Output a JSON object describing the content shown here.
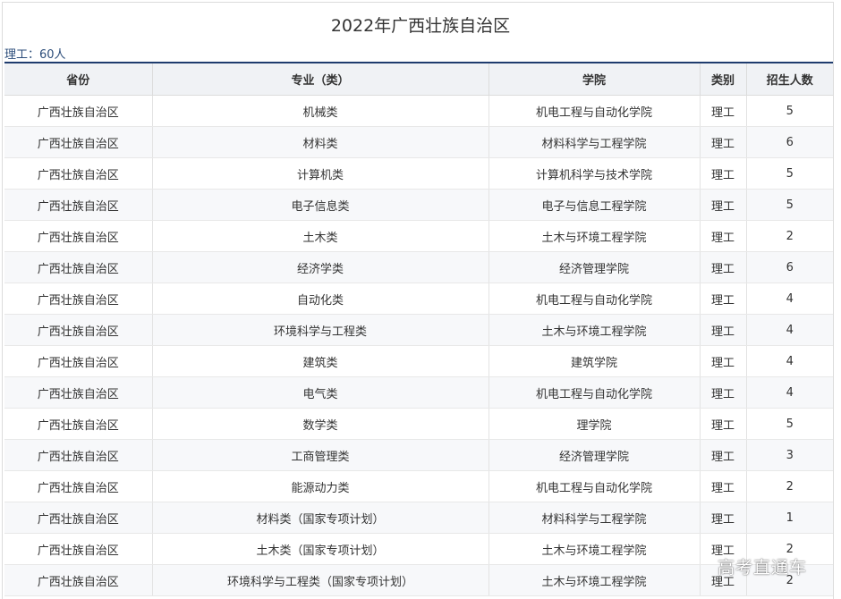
{
  "title": "2022年广西壮族自治区",
  "summary": "理工：60人",
  "table": {
    "headers": [
      "省份",
      "专业（类）",
      "学院",
      "类别",
      "招生人数"
    ],
    "rows": [
      [
        "广西壮族自治区",
        "机械类",
        "机电工程与自动化学院",
        "理工",
        "5"
      ],
      [
        "广西壮族自治区",
        "材料类",
        "材料科学与工程学院",
        "理工",
        "6"
      ],
      [
        "广西壮族自治区",
        "计算机类",
        "计算机科学与技术学院",
        "理工",
        "5"
      ],
      [
        "广西壮族自治区",
        "电子信息类",
        "电子与信息工程学院",
        "理工",
        "5"
      ],
      [
        "广西壮族自治区",
        "土木类",
        "土木与环境工程学院",
        "理工",
        "2"
      ],
      [
        "广西壮族自治区",
        "经济学类",
        "经济管理学院",
        "理工",
        "6"
      ],
      [
        "广西壮族自治区",
        "自动化类",
        "机电工程与自动化学院",
        "理工",
        "4"
      ],
      [
        "广西壮族自治区",
        "环境科学与工程类",
        "土木与环境工程学院",
        "理工",
        "4"
      ],
      [
        "广西壮族自治区",
        "建筑类",
        "建筑学院",
        "理工",
        "4"
      ],
      [
        "广西壮族自治区",
        "电气类",
        "机电工程与自动化学院",
        "理工",
        "4"
      ],
      [
        "广西壮族自治区",
        "数学类",
        "理学院",
        "理工",
        "5"
      ],
      [
        "广西壮族自治区",
        "工商管理类",
        "经济管理学院",
        "理工",
        "3"
      ],
      [
        "广西壮族自治区",
        "能源动力类",
        "机电工程与自动化学院",
        "理工",
        "2"
      ],
      [
        "广西壮族自治区",
        "材料类（国家专项计划）",
        "材料科学与工程学院",
        "理工",
        "1"
      ],
      [
        "广西壮族自治区",
        "土木类（国家专项计划）",
        "土木与环境工程学院",
        "理工",
        "2"
      ],
      [
        "广西壮族自治区",
        "环境科学与工程类（国家专项计划）",
        "土木与环境工程学院",
        "理工",
        "2"
      ]
    ]
  },
  "watermark": "高考直通车"
}
